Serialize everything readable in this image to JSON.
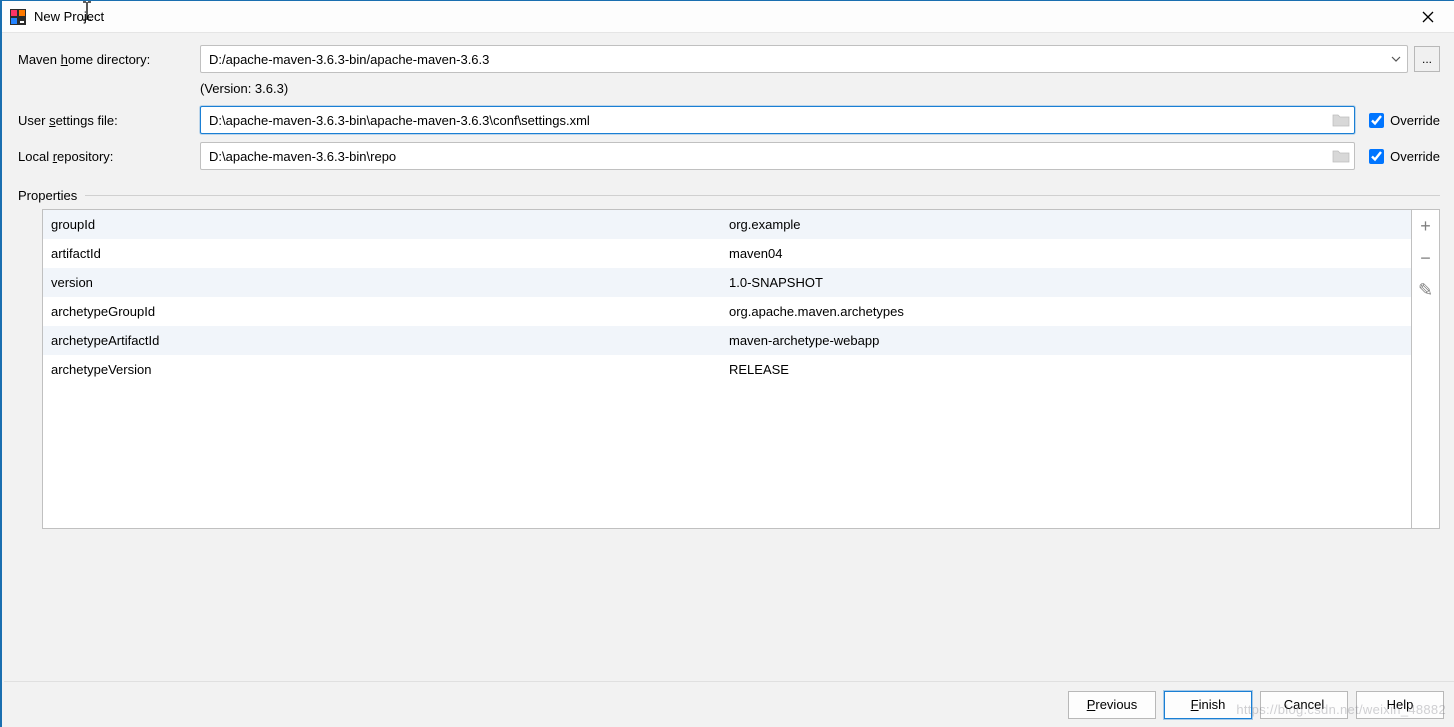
{
  "window": {
    "title": "New Project"
  },
  "form": {
    "mavenHome": {
      "label_pre": "Maven ",
      "label_ul": "h",
      "label_post": "ome directory:",
      "value": "D:/apache-maven-3.6.3-bin/apache-maven-3.6.3"
    },
    "versionText": "(Version: 3.6.3)",
    "userSettings": {
      "label_pre": "User ",
      "label_ul": "s",
      "label_post": "ettings file:",
      "value": "D:\\apache-maven-3.6.3-bin\\apache-maven-3.6.3\\conf\\settings.xml",
      "overrideLabel": "Override",
      "overrideChecked": true
    },
    "localRepo": {
      "label_pre": "Local ",
      "label_ul": "r",
      "label_post": "epository:",
      "value": "D:\\apache-maven-3.6.3-bin\\repo",
      "overrideLabel": "Override",
      "overrideChecked": true
    }
  },
  "propertiesLabel": "Properties",
  "properties": [
    {
      "key": "groupId",
      "value": "org.example"
    },
    {
      "key": "artifactId",
      "value": "maven04"
    },
    {
      "key": "version",
      "value": "1.0-SNAPSHOT"
    },
    {
      "key": "archetypeGroupId",
      "value": "org.apache.maven.archetypes"
    },
    {
      "key": "archetypeArtifactId",
      "value": "maven-archetype-webapp"
    },
    {
      "key": "archetypeVersion",
      "value": "RELEASE"
    }
  ],
  "buttons": {
    "previous_ul": "P",
    "previous_post": "revious",
    "finish_ul": "F",
    "finish_post": "inish",
    "cancel": "Cancel",
    "help": "Help"
  },
  "browseEllipsis": "...",
  "icons": {
    "add": "+",
    "remove": "−",
    "edit": "✎"
  }
}
